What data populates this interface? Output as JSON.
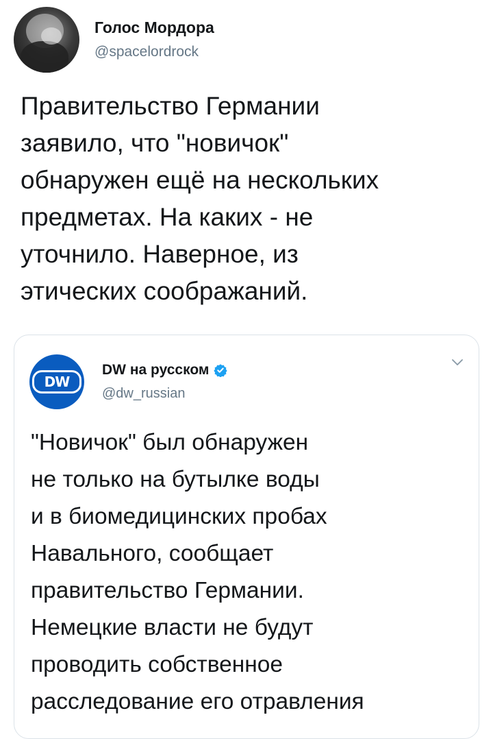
{
  "tweet": {
    "author": {
      "name": "Голос Мордора",
      "handle": "@spacelordrock",
      "avatar_icon": "avatar-photo"
    },
    "text": "Правительство Германии\nзаявило, что \"новичок\"\nобнаружен ещё на нескольких\nпредметах. На каких - не\nуточнило. Наверное, из\nэтических соображаний."
  },
  "quoted_tweet": {
    "author": {
      "name": "DW на русском",
      "handle": "@dw_russian",
      "logo_text": "DW",
      "verified": true,
      "verified_icon": "verified-badge-icon"
    },
    "menu_icon": "chevron-down-icon",
    "text": "\"Новичок\" был обнаружен\nне только на бутылке воды\nи в биомедицинских пробах\nНавального, сообщает\nправительство Германии.\nНемецкие власти не будут\nпроводить собственное\nрасследование его отравления"
  },
  "colors": {
    "text": "#14171a",
    "secondary_text": "#657786",
    "border": "#dbe2e8",
    "verified": "#1da1f2",
    "dw_brand": "#0a5cbf"
  }
}
